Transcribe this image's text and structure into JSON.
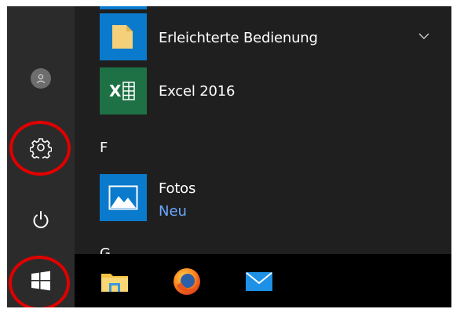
{
  "apps": [
    {
      "name": "Erleichterte Bedienung",
      "icon": "folder-icon",
      "tile_color": "#0a7acc"
    },
    {
      "name": "Excel 2016",
      "icon": "excel-icon",
      "tile_color": "#1e7145"
    },
    {
      "name": "Fotos",
      "subtitle": "Neu",
      "icon": "photos-icon",
      "tile_color": "#0a7acc"
    }
  ],
  "section_letters": [
    "F",
    "G"
  ],
  "rail": {
    "items": [
      "user-icon",
      "settings-icon",
      "power-icon"
    ]
  },
  "taskbar": {
    "items": [
      "start-icon",
      "file-explorer-icon",
      "firefox-icon",
      "mail-icon"
    ]
  },
  "colors": {
    "highlight": "#e00000",
    "accent": "#0a7acc",
    "subtitle": "#6aa8ff"
  }
}
